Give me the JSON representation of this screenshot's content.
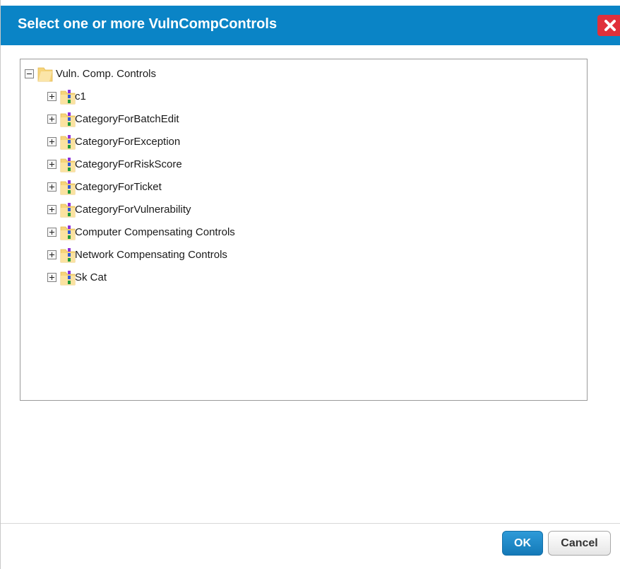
{
  "dialog": {
    "title": "Select one or more VulnCompControls",
    "ok_label": "OK",
    "cancel_label": "Cancel"
  },
  "tree": {
    "root": {
      "label": "Vuln. Comp. Controls",
      "expanded": true
    },
    "children": [
      {
        "label": "c1"
      },
      {
        "label": "CategoryForBatchEdit"
      },
      {
        "label": "CategoryForException"
      },
      {
        "label": "CategoryForRiskScore"
      },
      {
        "label": "CategoryForTicket"
      },
      {
        "label": "CategoryForVulnerability"
      },
      {
        "label": "Computer Compensating Controls"
      },
      {
        "label": "Network Compensating Controls"
      },
      {
        "label": "Sk Cat"
      }
    ]
  },
  "colors": {
    "title_bar": "#0a84c6",
    "close_button": "#e0303a",
    "ok_button": "#1a86c8",
    "folder": "#f6d47a"
  },
  "icons": {
    "close": "close-icon",
    "toggle_expanded": "minus-box-icon",
    "toggle_collapsed": "plus-box-icon",
    "folder_open": "folder-open-icon",
    "folder": "folder-icon",
    "category": "category-icon"
  }
}
